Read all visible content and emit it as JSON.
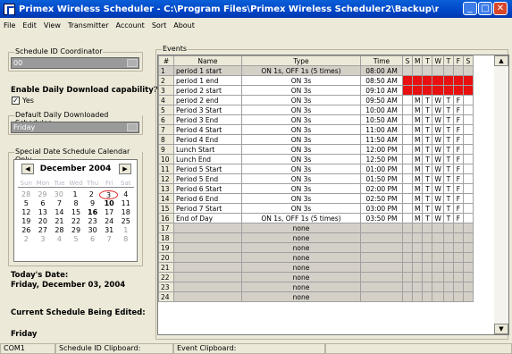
{
  "window": {
    "title": "Primex Wireless Scheduler - C:\\Program Files\\Primex Wireless Scheduler2\\Backup\\new program previe..."
  },
  "menu": [
    "File",
    "Edit",
    "View",
    "Transmitter",
    "Account",
    "Sort",
    "About"
  ],
  "left": {
    "schedule_id_label": "Schedule ID Coordinator",
    "schedule_id_value": "00",
    "daily_download_label": "Enable Daily Download capability?",
    "yes_label": "Yes",
    "yes_checked": true,
    "default_daily_label": "Default Daily Downloaded Schedules",
    "default_daily_value": "Friday",
    "special_label": "Special Date Schedule Calendar Only",
    "todays_date_label": "Today's Date:",
    "todays_date_value": "Friday, December 03, 2004",
    "current_schedule_label": "Current Schedule Being Edited:",
    "current_schedule_value": "Friday"
  },
  "calendar": {
    "month": "December 2004",
    "dow": [
      "Sun",
      "Mon",
      "Tue",
      "Wed",
      "Thu",
      "Fri",
      "Sat"
    ],
    "weeks": [
      [
        {
          "d": "28",
          "dim": true
        },
        {
          "d": "29",
          "dim": true
        },
        {
          "d": "30",
          "dim": true
        },
        {
          "d": "1"
        },
        {
          "d": "2"
        },
        {
          "d": "3",
          "sel": true
        },
        {
          "d": "4"
        }
      ],
      [
        {
          "d": "5"
        },
        {
          "d": "6"
        },
        {
          "d": "7"
        },
        {
          "d": "8"
        },
        {
          "d": "9"
        },
        {
          "d": "10",
          "bold": true
        },
        {
          "d": "11"
        }
      ],
      [
        {
          "d": "12"
        },
        {
          "d": "13"
        },
        {
          "d": "14"
        },
        {
          "d": "15"
        },
        {
          "d": "16",
          "bold": true
        },
        {
          "d": "17"
        },
        {
          "d": "18"
        }
      ],
      [
        {
          "d": "19"
        },
        {
          "d": "20"
        },
        {
          "d": "21"
        },
        {
          "d": "22"
        },
        {
          "d": "23"
        },
        {
          "d": "24"
        },
        {
          "d": "25"
        }
      ],
      [
        {
          "d": "26"
        },
        {
          "d": "27"
        },
        {
          "d": "28"
        },
        {
          "d": "29"
        },
        {
          "d": "30"
        },
        {
          "d": "31"
        },
        {
          "d": "1",
          "dim": true
        }
      ],
      [
        {
          "d": "2",
          "dim": true
        },
        {
          "d": "3",
          "dim": true
        },
        {
          "d": "4",
          "dim": true
        },
        {
          "d": "5",
          "dim": true
        },
        {
          "d": "6",
          "dim": true
        },
        {
          "d": "7",
          "dim": true
        },
        {
          "d": "8",
          "dim": true
        }
      ]
    ]
  },
  "events": {
    "label": "Events",
    "columns": [
      "#",
      "Name",
      "Type",
      "Time",
      "S",
      "M",
      "T",
      "W",
      "T",
      "F",
      "S"
    ],
    "rows": [
      {
        "n": "1",
        "name": "period 1 start",
        "type": "ON 1s, OFF 1s (5 times)",
        "time": "08:00 AM",
        "days": [
          "",
          "",
          "",
          "",
          "",
          "",
          ""
        ],
        "red": true,
        "first": true
      },
      {
        "n": "2",
        "name": "period 1 end",
        "type": "ON 3s",
        "time": "08:50 AM",
        "days": [
          "",
          "",
          "",
          "",
          "",
          "",
          ""
        ],
        "red": true
      },
      {
        "n": "3",
        "name": "period 2 start",
        "type": "ON 3s",
        "time": "09:10 AM",
        "days": [
          "",
          "",
          "",
          "",
          "",
          "",
          ""
        ],
        "red": true
      },
      {
        "n": "4",
        "name": "period 2 end",
        "type": "ON 3s",
        "time": "09:50 AM",
        "days": [
          "",
          "M",
          "T",
          "W",
          "T",
          "F",
          ""
        ]
      },
      {
        "n": "5",
        "name": "Period 3 Start",
        "type": "ON 3s",
        "time": "10:00 AM",
        "days": [
          "",
          "M",
          "T",
          "W",
          "T",
          "F",
          ""
        ]
      },
      {
        "n": "6",
        "name": "Period 3 End",
        "type": "ON 3s",
        "time": "10:50 AM",
        "days": [
          "",
          "M",
          "T",
          "W",
          "T",
          "F",
          ""
        ]
      },
      {
        "n": "7",
        "name": "Period 4 Start",
        "type": "ON 3s",
        "time": "11:00 AM",
        "days": [
          "",
          "M",
          "T",
          "W",
          "T",
          "F",
          ""
        ]
      },
      {
        "n": "8",
        "name": "Period 4 End",
        "type": "ON 3s",
        "time": "11:50 AM",
        "days": [
          "",
          "M",
          "T",
          "W",
          "T",
          "F",
          ""
        ]
      },
      {
        "n": "9",
        "name": "Lunch Start",
        "type": "ON 3s",
        "time": "12:00 PM",
        "days": [
          "",
          "M",
          "T",
          "W",
          "T",
          "F",
          ""
        ]
      },
      {
        "n": "10",
        "name": "Lunch End",
        "type": "ON 3s",
        "time": "12:50 PM",
        "days": [
          "",
          "M",
          "T",
          "W",
          "T",
          "F",
          ""
        ]
      },
      {
        "n": "11",
        "name": "Period 5 Start",
        "type": "ON 3s",
        "time": "01:00 PM",
        "days": [
          "",
          "M",
          "T",
          "W",
          "T",
          "F",
          ""
        ]
      },
      {
        "n": "12",
        "name": "Period 5 End",
        "type": "ON 3s",
        "time": "01:50 PM",
        "days": [
          "",
          "M",
          "T",
          "W",
          "T",
          "F",
          ""
        ]
      },
      {
        "n": "13",
        "name": "Period 6 Start",
        "type": "ON 3s",
        "time": "02:00 PM",
        "days": [
          "",
          "M",
          "T",
          "W",
          "T",
          "F",
          ""
        ]
      },
      {
        "n": "14",
        "name": "Period 6 End",
        "type": "ON 3s",
        "time": "02:50 PM",
        "days": [
          "",
          "M",
          "T",
          "W",
          "T",
          "F",
          ""
        ]
      },
      {
        "n": "15",
        "name": "Period 7 Start",
        "type": "ON 3s",
        "time": "03:00 PM",
        "days": [
          "",
          "M",
          "T",
          "W",
          "T",
          "F",
          ""
        ]
      },
      {
        "n": "16",
        "name": "End of Day",
        "type": "ON 1s, OFF 1s (5 times)",
        "time": "03:50 PM",
        "days": [
          "",
          "M",
          "T",
          "W",
          "T",
          "F",
          ""
        ]
      },
      {
        "n": "17",
        "name": "",
        "type": "none",
        "time": "",
        "days": [
          "",
          "",
          "",
          "",
          "",
          "",
          ""
        ],
        "grey": true
      },
      {
        "n": "18",
        "name": "",
        "type": "none",
        "time": "",
        "days": [
          "",
          "",
          "",
          "",
          "",
          "",
          ""
        ],
        "grey": true
      },
      {
        "n": "19",
        "name": "",
        "type": "none",
        "time": "",
        "days": [
          "",
          "",
          "",
          "",
          "",
          "",
          ""
        ],
        "grey": true
      },
      {
        "n": "20",
        "name": "",
        "type": "none",
        "time": "",
        "days": [
          "",
          "",
          "",
          "",
          "",
          "",
          ""
        ],
        "grey": true
      },
      {
        "n": "21",
        "name": "",
        "type": "none",
        "time": "",
        "days": [
          "",
          "",
          "",
          "",
          "",
          "",
          ""
        ],
        "grey": true
      },
      {
        "n": "22",
        "name": "",
        "type": "none",
        "time": "",
        "days": [
          "",
          "",
          "",
          "",
          "",
          "",
          ""
        ],
        "grey": true
      },
      {
        "n": "23",
        "name": "",
        "type": "none",
        "time": "",
        "days": [
          "",
          "",
          "",
          "",
          "",
          "",
          ""
        ],
        "grey": true
      },
      {
        "n": "24",
        "name": "",
        "type": "none",
        "time": "",
        "days": [
          "",
          "",
          "",
          "",
          "",
          "",
          ""
        ],
        "grey": true
      }
    ]
  },
  "status": {
    "port": "COM1",
    "schedule_clipboard": "Schedule ID Clipboard:",
    "event_clipboard": "Event Clipboard:"
  },
  "colors": {
    "title_bar": "#0046c7",
    "red_cell": "#e81010",
    "combo_bg": "#9a9a9a"
  }
}
